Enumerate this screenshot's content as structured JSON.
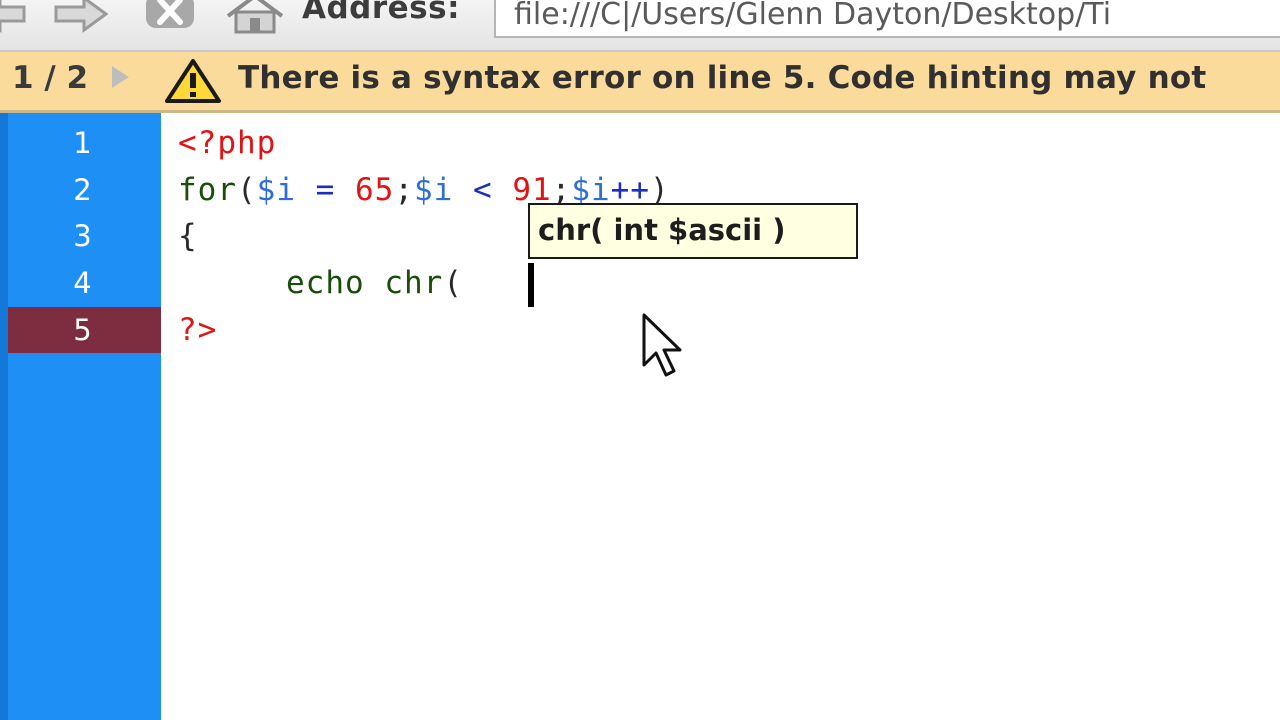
{
  "toolbar": {
    "address_label": "Address:",
    "address_value": "file:///C|/Users/Glenn Dayton/Desktop/Ti",
    "buttons": [
      "back-arrow-icon",
      "forward-arrow-icon",
      "stop-icon",
      "home-icon"
    ]
  },
  "warning": {
    "pager": "1 / 2",
    "message": "There is a syntax error on line 5.  Code hinting may not"
  },
  "editor": {
    "line_numbers": [
      "1",
      "2",
      "3",
      "4",
      "5"
    ],
    "error_line": "5",
    "lines": {
      "l1": {
        "tag": "<?php"
      },
      "l2": {
        "kw": "for",
        "p1": "(",
        "var1": "$i",
        "op1": " = ",
        "num1": "65",
        "p2": ";",
        "var2": "$i",
        "op2": " < ",
        "num2": "91",
        "p3": ";",
        "var3": "$i",
        "op3": "++",
        "p4": ")"
      },
      "l3": {
        "brace": "{"
      },
      "l4": {
        "fn": "echo chr",
        "paren": "("
      },
      "l5": {
        "tag": "?>"
      }
    }
  },
  "hint": {
    "text": "chr( int $ascii )"
  },
  "colors": {
    "gutter": "#1e8ff5",
    "error_line": "#7e2c3f",
    "warning_bar": "#fadb9c",
    "tag": "#e01414",
    "variable": "#2f6fd3",
    "hint_bg": "#ffffe1"
  }
}
